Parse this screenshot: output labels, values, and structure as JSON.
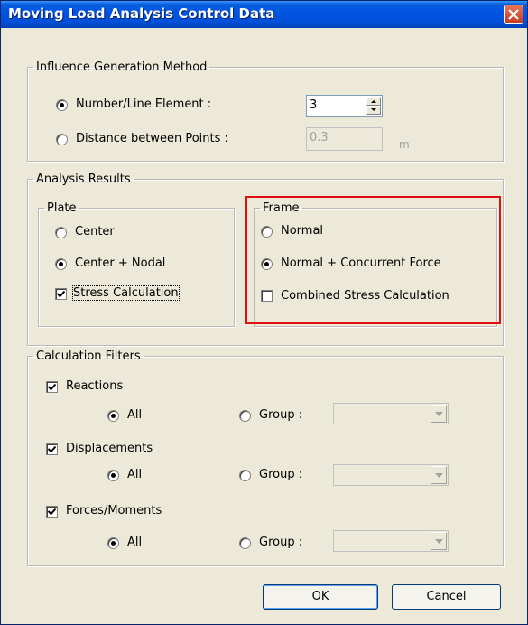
{
  "window": {
    "title": "Moving Load Analysis Control Data"
  },
  "influence": {
    "legend": "Influence Generation Method",
    "option1_label": "Number/Line Element :",
    "option1_value": "3",
    "option2_label": "Distance between Points :",
    "option2_value": "0.3",
    "option2_unit": "m",
    "selected": "Number/Line Element"
  },
  "analysis": {
    "legend": "Analysis Results",
    "plate": {
      "legend": "Plate",
      "opt_center": "Center",
      "opt_center_nodal": "Center + Nodal",
      "stress": "Stress Calculation",
      "selected": "Center + Nodal",
      "stress_checked": true
    },
    "frame": {
      "legend": "Frame",
      "opt_normal": "Normal",
      "opt_normal_concurrent": "Normal + Concurrent Force",
      "combined": "Combined Stress Calculation",
      "selected": "Normal + Concurrent Force",
      "combined_checked": false
    }
  },
  "filters": {
    "legend": "Calculation Filters",
    "reactions": {
      "label": "Reactions",
      "checked": true,
      "all": "All",
      "group": "Group :"
    },
    "displacements": {
      "label": "Displacements",
      "checked": true,
      "all": "All",
      "group": "Group :"
    },
    "forces": {
      "label": "Forces/Moments",
      "checked": true,
      "all": "All",
      "group": "Group :"
    }
  },
  "buttons": {
    "ok": "OK",
    "cancel": "Cancel"
  },
  "colors": {
    "title_bar": "#0054e3",
    "dialog_bg": "#ece9d8",
    "highlight": "#e01010"
  }
}
